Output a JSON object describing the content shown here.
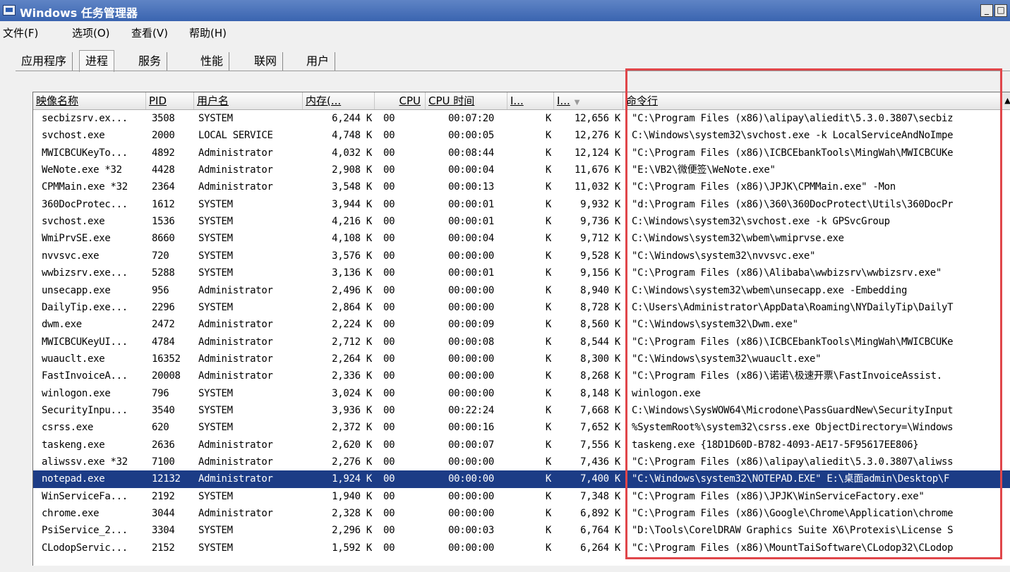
{
  "window": {
    "title": "Windows 任务管理器",
    "minimize_label": "_",
    "restore_label": "□"
  },
  "menu": [
    "文件(F)",
    "选项(O)",
    "查看(V)",
    "帮助(H)"
  ],
  "tabs": [
    {
      "label": "应用程序",
      "active": false
    },
    {
      "label": "进程",
      "active": true
    },
    {
      "label": "服务",
      "active": false
    },
    {
      "label": "性能",
      "active": false
    },
    {
      "label": "联网",
      "active": false
    },
    {
      "label": "用户",
      "active": false
    }
  ],
  "columns": [
    "映像名称",
    "PID",
    "用户名",
    "内存(...",
    "CPU",
    "CPU 时间",
    "I...",
    "I...",
    "命令行"
  ],
  "rows": [
    [
      "secbizsrv.ex...",
      "3508",
      "SYSTEM",
      "6,244 K",
      "00",
      "00:07:20",
      "K",
      "12,656 K",
      "\"C:\\Program Files (x86)\\alipay\\aliedit\\5.3.0.3807\\secbiz"
    ],
    [
      "svchost.exe",
      "2000",
      "LOCAL SERVICE",
      "4,748 K",
      "00",
      "00:00:05",
      "K",
      "12,276 K",
      "C:\\Windows\\system32\\svchost.exe -k LocalServiceAndNoImpe"
    ],
    [
      "MWICBCUKeyTo...",
      "4892",
      "Administrator",
      "4,032 K",
      "00",
      "00:08:44",
      "K",
      "12,124 K",
      "\"C:\\Program Files (x86)\\ICBCEbankTools\\MingWah\\MWICBCUKe"
    ],
    [
      "WeNote.exe *32",
      "4428",
      "Administrator",
      "2,908 K",
      "00",
      "00:00:04",
      "K",
      "11,676 K",
      "\"E:\\VB2\\微便签\\WeNote.exe\""
    ],
    [
      "CPMMain.exe *32",
      "2364",
      "Administrator",
      "3,548 K",
      "00",
      "00:00:13",
      "K",
      "11,032 K",
      "\"C:\\Program Files (x86)\\JPJK\\CPMMain.exe\" -Mon"
    ],
    [
      "360DocProtec...",
      "1612",
      "SYSTEM",
      "3,944 K",
      "00",
      "00:00:01",
      "K",
      "9,932 K",
      "\"d:\\Program Files (x86)\\360\\360DocProtect\\Utils\\360DocPr"
    ],
    [
      "svchost.exe",
      "1536",
      "SYSTEM",
      "4,216 K",
      "00",
      "00:00:01",
      "K",
      "9,736 K",
      "C:\\Windows\\system32\\svchost.exe -k GPSvcGroup"
    ],
    [
      "WmiPrvSE.exe",
      "8660",
      "SYSTEM",
      "4,108 K",
      "00",
      "00:00:04",
      "K",
      "9,712 K",
      "C:\\Windows\\system32\\wbem\\wmiprvse.exe"
    ],
    [
      "nvvsvc.exe",
      "720",
      "SYSTEM",
      "3,576 K",
      "00",
      "00:00:00",
      "K",
      "9,528 K",
      "\"C:\\Windows\\system32\\nvvsvc.exe\""
    ],
    [
      "wwbizsrv.exe...",
      "5288",
      "SYSTEM",
      "3,136 K",
      "00",
      "00:00:01",
      "K",
      "9,156 K",
      "\"C:\\Program Files (x86)\\Alibaba\\wwbizsrv\\wwbizsrv.exe\""
    ],
    [
      "unsecapp.exe",
      "956",
      "Administrator",
      "2,496 K",
      "00",
      "00:00:00",
      "K",
      "8,940 K",
      "C:\\Windows\\system32\\wbem\\unsecapp.exe -Embedding"
    ],
    [
      "DailyTip.exe...",
      "2296",
      "SYSTEM",
      "2,864 K",
      "00",
      "00:00:00",
      "K",
      "8,728 K",
      "C:\\Users\\Administrator\\AppData\\Roaming\\NYDailyTip\\DailyT"
    ],
    [
      "dwm.exe",
      "2472",
      "Administrator",
      "2,224 K",
      "00",
      "00:00:09",
      "K",
      "8,560 K",
      "\"C:\\Windows\\system32\\Dwm.exe\""
    ],
    [
      "MWICBCUKeyUI...",
      "4784",
      "Administrator",
      "2,712 K",
      "00",
      "00:00:08",
      "K",
      "8,544 K",
      "\"C:\\Program Files (x86)\\ICBCEbankTools\\MingWah\\MWICBCUKe"
    ],
    [
      "wuauclt.exe",
      "16352",
      "Administrator",
      "2,264 K",
      "00",
      "00:00:00",
      "K",
      "8,300 K",
      "\"C:\\Windows\\system32\\wuauclt.exe\""
    ],
    [
      "FastInvoiceA...",
      "20008",
      "Administrator",
      "2,336 K",
      "00",
      "00:00:00",
      "K",
      "8,268 K",
      "\"C:\\Program Files (x86)\\诺诺\\极速开票\\FastInvoiceAssist."
    ],
    [
      "winlogon.exe",
      "796",
      "SYSTEM",
      "3,024 K",
      "00",
      "00:00:00",
      "K",
      "8,148 K",
      "winlogon.exe"
    ],
    [
      "SecurityInpu...",
      "3540",
      "SYSTEM",
      "3,936 K",
      "00",
      "00:22:24",
      "K",
      "7,668 K",
      "C:\\Windows\\SysWOW64\\Microdone\\PassGuardNew\\SecurityInput"
    ],
    [
      "csrss.exe",
      "620",
      "SYSTEM",
      "2,372 K",
      "00",
      "00:00:16",
      "K",
      "7,652 K",
      "%SystemRoot%\\system32\\csrss.exe ObjectDirectory=\\Windows"
    ],
    [
      "taskeng.exe",
      "2636",
      "Administrator",
      "2,620 K",
      "00",
      "00:00:07",
      "K",
      "7,556 K",
      "taskeng.exe {18D1D60D-B782-4093-AE17-5F95617EE806}"
    ],
    [
      "aliwssv.exe *32",
      "7100",
      "Administrator",
      "2,276 K",
      "00",
      "00:00:00",
      "K",
      "7,436 K",
      "\"C:\\Program Files (x86)\\alipay\\aliedit\\5.3.0.3807\\aliwss"
    ],
    [
      "notepad.exe",
      "12132",
      "Administrator",
      "1,924 K",
      "00",
      "00:00:00",
      "K",
      "7,400 K",
      "\"C:\\Windows\\system32\\NOTEPAD.EXE\" E:\\桌面admin\\Desktop\\F"
    ],
    [
      "WinServiceFa...",
      "2192",
      "SYSTEM",
      "1,940 K",
      "00",
      "00:00:00",
      "K",
      "7,348 K",
      "\"C:\\Program Files (x86)\\JPJK\\WinServiceFactory.exe\""
    ],
    [
      "chrome.exe",
      "3044",
      "Administrator",
      "2,328 K",
      "00",
      "00:00:00",
      "K",
      "6,892 K",
      "\"C:\\Program Files (x86)\\Google\\Chrome\\Application\\chrome"
    ],
    [
      "PsiService_2...",
      "3304",
      "SYSTEM",
      "2,296 K",
      "00",
      "00:00:03",
      "K",
      "6,764 K",
      "\"D:\\Tools\\CorelDRAW Graphics Suite X6\\Protexis\\License S"
    ],
    [
      "CLodopServic...",
      "2152",
      "SYSTEM",
      "1,592 K",
      "00",
      "00:00:00",
      "K",
      "6,264 K",
      "\"C:\\Program Files (x86)\\MountTaiSoftware\\CLodop32\\CLodop"
    ]
  ],
  "selected_row": 21
}
